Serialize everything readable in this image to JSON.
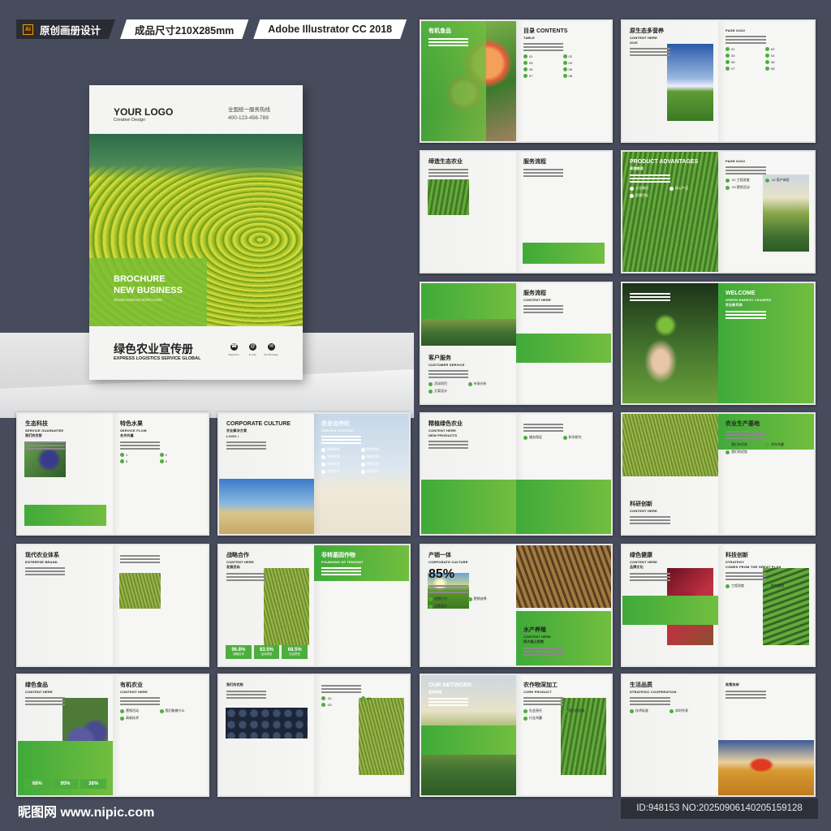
{
  "header": {
    "app_badge": "Ai",
    "tag_original": "原创画册设计",
    "tag_size": "成品尺寸210X285mm",
    "tag_software": "Adobe Illustrator CC 2018"
  },
  "cover": {
    "logo": "YOUR LOGO",
    "logo_sub": "Creative Design",
    "hotline_label": "全国统一服务热线",
    "hotline_number": "400-123-456-789",
    "title_line1": "BROCHURE",
    "title_line2": "NEW BUSINESS",
    "subtitle": "NEWBUSINESS BORCHURE",
    "cn_title": "绿色农业宣传册",
    "en_title": "EXPRESS LOGISTICS SERVICE GLOBAL",
    "contacts": [
      "Telephone",
      "E-mail",
      "We Message"
    ]
  },
  "spreads": [
    {
      "left": {
        "title": "有机食品"
      },
      "right": {
        "title": "目录 CONTENTS",
        "sub": "TABLE",
        "items": [
          "01",
          "02",
          "03",
          "04",
          "05",
          "06",
          "07",
          "08"
        ]
      }
    },
    {
      "left": {
        "title": "原生态多营养",
        "sub": "CONTENT HERE",
        "extra": "2025"
      },
      "right": {
        "sub": "PAGE 01/02",
        "items": [
          "01",
          "02",
          "03",
          "04",
          "05",
          "06",
          "07",
          "08"
        ]
      }
    },
    {
      "left": {
        "title": "缔造生态农业"
      },
      "right": {
        "title": "服务流程"
      }
    },
    {
      "left": {
        "title": "PRODUCT ADVANTAGES",
        "sub": "缔造眼润",
        "items": [
          "企业概况",
          "核心产品",
          "愿景目标"
        ]
      },
      "right": {
        "sub": "PAGE 01/02",
        "items": [
          ".01 工程进度",
          ".02 用户体验",
          ".03 营销活动"
        ]
      }
    },
    {
      "left": {
        "title": "客户服务",
        "sub": "CUSTOMER SERVICE",
        "items": [
          "活动项目",
          "市场分析",
          "方案设计"
        ]
      },
      "right": {
        "title": "服务流程",
        "sub": "CONTENT HERE"
      }
    },
    {
      "left": {},
      "right": {
        "title": "WELCOME",
        "sub": "GREEN ENERGY LEADERS",
        "extra": "农业新风尚"
      }
    },
    {
      "left": {
        "title": "生态科技",
        "sub": "SERVICE GUARANTEE",
        "extra": "我们的优势"
      },
      "right": {
        "title": "特色水果",
        "sub": "SERVICE FLOW",
        "extra": "合作共赢",
        "items": [
          "1",
          "2",
          "3",
          "4"
        ]
      }
    },
    {
      "left": {
        "title": "CORPORATE CULTURE",
        "sub": "农业解决方案",
        "extra": "LOGO /"
      },
      "right": {
        "title": "农业合作社",
        "sub": "SERVICE CONTENT",
        "items": [
          "独特优势",
          "独特优势",
          "独特优势",
          "独特优势",
          "独特优势",
          "独特优势",
          "独特优势",
          "独特优势"
        ]
      }
    },
    {
      "left": {
        "title": "精植绿色农业",
        "sub": "CONTENT HERE",
        "extra": "NEW PRODUCTS"
      },
      "right": {
        "items": [
          "服务保证",
          "科学研究"
        ]
      }
    },
    {
      "left": {
        "title": "科研创新",
        "sub": "CONTENT HERE"
      },
      "right": {
        "title": "农业生产基地",
        "items": [
          "我们的优势",
          "合作共赢",
          "我们的优势"
        ]
      }
    },
    {
      "left": {
        "title": "现代农业体系",
        "sub": "ENTERPSE BRAND"
      },
      "right": {}
    },
    {
      "left": {
        "title": "战略合作",
        "sub": "CONTENT HERE",
        "extra": "发展目标",
        "stats": [
          {
            "v": "96.8%",
            "l": "战略合作"
          },
          {
            "v": "83.5%",
            "l": "活动项目"
          },
          {
            "v": "68.5%",
            "l": "社会责任"
          }
        ]
      },
      "right": {
        "title": "非转基因作物",
        "sub": "FOUNDING OF TENCENT"
      }
    },
    {
      "left": {
        "title": "产销一体",
        "sub": "CORPORATE CULTURE",
        "extra": "85%",
        "items": [
          "经营行为",
          "营销选择",
          "方案设计"
        ]
      },
      "right": {
        "title": "水产养殖",
        "sub": "CONTENT HERE",
        "extra": "四大核心优势"
      }
    },
    {
      "left": {
        "title": "绿色健康",
        "sub": "CONTENT HERE",
        "extra": "品牌文化"
      },
      "right": {
        "title": "科技创新",
        "sub": "STRATEGY",
        "extra": "COMES FROM THE GREAT PLAN",
        "items": [
          "工程进度",
          "联合监理"
        ]
      }
    },
    {
      "left": {
        "title": "绿色食品",
        "sub": "CONTENT HERE",
        "stats": [
          {
            "v": "68%",
            "l": ""
          },
          {
            "v": "95%",
            "l": ""
          },
          {
            "v": "38%",
            "l": ""
          }
        ]
      },
      "right": {
        "title": "有机农业",
        "sub": "CONTENT HERE",
        "items": [
          "营销活动",
          "我们能做什么",
          "高新技术"
        ]
      }
    },
    {
      "left": {
        "extra": "我们的优势"
      },
      "right": {
        "items": [
          ".01",
          ".02",
          ".03"
        ]
      }
    },
    {
      "left": {
        "title": "OUR NETWORK",
        "sub": "服务网络"
      },
      "right": {
        "title": "农作物深加工",
        "sub": "CORE PRODUCT",
        "items": [
          "社会责任",
          "我们的优势",
          "行业共赢"
        ]
      }
    },
    {
      "left": {
        "title": "生活品质",
        "sub": "STRATEGIC COOPERATION",
        "items": [
          "技术标准",
          "实时共享"
        ]
      },
      "right": {
        "extra": "政策扶持"
      }
    }
  ],
  "footer": {
    "watermark": "昵图网 www.nipic.com",
    "id_text": "ID:948153 NO:20250906140205159128"
  },
  "colors": {
    "background": "#474c5c",
    "accent_green": "#4cae3c"
  }
}
